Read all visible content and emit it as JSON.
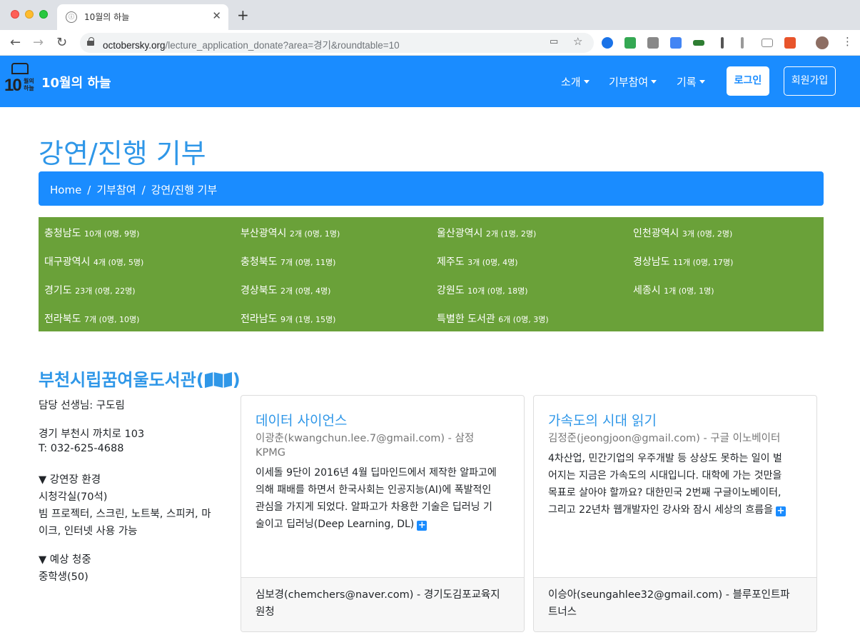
{
  "browser": {
    "tab_title": "10월의 하늘",
    "tab_favicon": "ⓘ",
    "url_host": "octobersky.org",
    "url_path": "/lecture_application_donate?area=경기&roundtable=10"
  },
  "navbar": {
    "brand": "10월의 하늘",
    "logo_number": "10",
    "logo_text": "월의 하늘",
    "menu": [
      "소개",
      "기부참여",
      "기록"
    ],
    "login": "로그인",
    "signup": "회원가입"
  },
  "page": {
    "title": "강연/진행 기부",
    "breadcrumb": [
      "Home",
      "기부참여",
      "강연/진행 기부"
    ],
    "breadcrumb_sep": "/"
  },
  "regions": [
    {
      "name": "충청남도",
      "count": "10개 (0명, 9명)"
    },
    {
      "name": "부산광역시",
      "count": "2개 (0명, 1명)"
    },
    {
      "name": "울산광역시",
      "count": "2개 (1명, 2명)"
    },
    {
      "name": "인천광역시",
      "count": "3개 (0명, 2명)"
    },
    {
      "name": "대구광역시",
      "count": "4개 (0명, 5명)"
    },
    {
      "name": "충청북도",
      "count": "7개 (0명, 11명)"
    },
    {
      "name": "제주도",
      "count": "3개 (0명, 4명)"
    },
    {
      "name": "경상남도",
      "count": "11개 (0명, 17명)"
    },
    {
      "name": "경기도",
      "count": "23개 (0명, 22명)"
    },
    {
      "name": "경상북도",
      "count": "2개 (0명, 4명)"
    },
    {
      "name": "강원도",
      "count": "10개 (0명, 18명)"
    },
    {
      "name": "세종시",
      "count": "1개 (0명, 1명)"
    },
    {
      "name": "전라북도",
      "count": "7개 (0명, 10명)"
    },
    {
      "name": "전라남도",
      "count": "9개 (1명, 15명)"
    },
    {
      "name": "특별한 도서관",
      "count": "6개 (0명, 3명)"
    }
  ],
  "library": {
    "name": "부천시립꿈여울도서관",
    "teacher": "담당 선생님: 구도림",
    "address": "경기 부천시 까치로 103",
    "phone": "T: 032-625-4688",
    "env_heading": "▼ 강연장 환경",
    "env_room": "시청각실(70석)",
    "env_equip_1": "빔 프로젝터, 스크린, 노트북, 스피커, 마",
    "env_equip_2": "이크, 인터넷 사용 가능",
    "audience_heading": "▼ 예상 청중",
    "audience": "중학생(50)"
  },
  "cards": [
    {
      "title": "데이터 사이언스",
      "author_1": "이광춘(kwangchun.lee.7@gmail.com) - 삼정",
      "author_2": "KPMG",
      "body": [
        "이세돌 9단이 2016년 4월 딥마인드에서 제작한 알파고에",
        "의해 패배를 하면서 한국사회는 인공지능(AI)에 폭발적인",
        "관심을 가지게 되었다. 알파고가 차용한 기술은 딥러닝 기",
        "술이고 딥러닝(Deep Learning, DL)"
      ],
      "more": "+",
      "footer_1": "심보경(chemchers@naver.com) - 경기도김포교육지",
      "footer_2": "원청"
    },
    {
      "title": "가속도의 시대 읽기",
      "author_1": "김정준(jeongjoon@gmail.com) - 구글 이노베이터",
      "author_2": "",
      "body": [
        "4차산업, 민간기업의 우주개발 등 상상도 못하는 일이 벌",
        "어지는 지금은 가속도의 시대입니다. 대학에 가는 것만을",
        "목표로 살아야 할까요? 대한민국 2번째 구글이노베이터,",
        "그리고 22년차 웹개발자인 강사와 잠시 세상의 흐름을"
      ],
      "more": "+",
      "footer_1": "이승아(seungahlee32@gmail.com) - 블루포인트파",
      "footer_2": "트너스"
    }
  ]
}
